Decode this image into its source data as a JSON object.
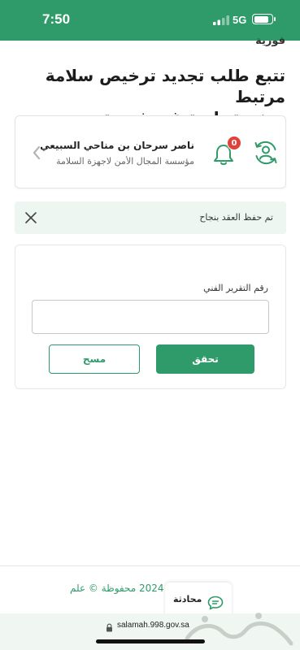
{
  "status_bar": {
    "time": "7:50",
    "network": "5G",
    "battery_level": 0.85
  },
  "header": {
    "cut_text": "فورية",
    "title_line1": "تتبع طلب تجديد ترخيص سلامة مرتبط",
    "title_line2": "برخصة بلدية غير فورية"
  },
  "user_card": {
    "name": "ناصر سرحان بن مناحي السبيعي",
    "organization": "مؤسسة المجال الأمن لاجهزة السلامة",
    "notification_count": "0"
  },
  "alert": {
    "message": "تم حفظ العقد بنجاح"
  },
  "form": {
    "field_label": "رقم التقرير الفني",
    "field_value": "",
    "verify_label": "تحقق",
    "clear_label": "مسح"
  },
  "footer": {
    "copyright": "2024 محفوظة © علم",
    "chat_label": "محادثة"
  },
  "browser": {
    "url": "salamah.998.gov.sa"
  },
  "colors": {
    "brand": "#2f9b6a",
    "badge": "#e0413b",
    "alert_bg": "#edf6f1"
  }
}
